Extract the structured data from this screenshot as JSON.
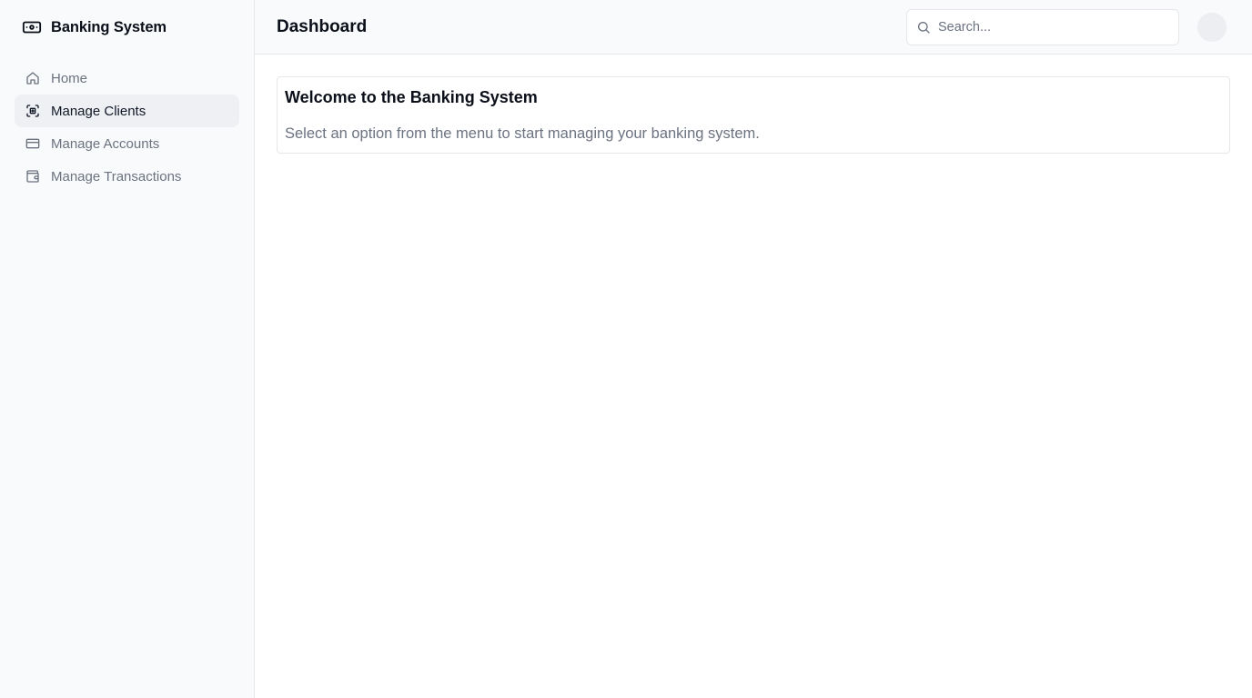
{
  "sidebar": {
    "brand": {
      "title": "Banking System",
      "icon": "banknote-icon"
    },
    "items": [
      {
        "label": "Home",
        "icon": "home-icon",
        "active": false
      },
      {
        "label": "Manage Clients",
        "icon": "scan-face-icon",
        "active": true
      },
      {
        "label": "Manage Accounts",
        "icon": "credit-card-icon",
        "active": false
      },
      {
        "label": "Manage Transactions",
        "icon": "wallet-icon",
        "active": false
      }
    ]
  },
  "header": {
    "title": "Dashboard",
    "search": {
      "placeholder": "Search...",
      "value": ""
    }
  },
  "main": {
    "card": {
      "title": "Welcome to the Banking System",
      "text": "Select an option from the menu to start managing your banking system."
    }
  },
  "colors": {
    "sidebar_bg": "#f9fafb",
    "active_item_bg": "#eef0f3",
    "muted_text": "#6b7280",
    "border": "#e5e7eb"
  }
}
